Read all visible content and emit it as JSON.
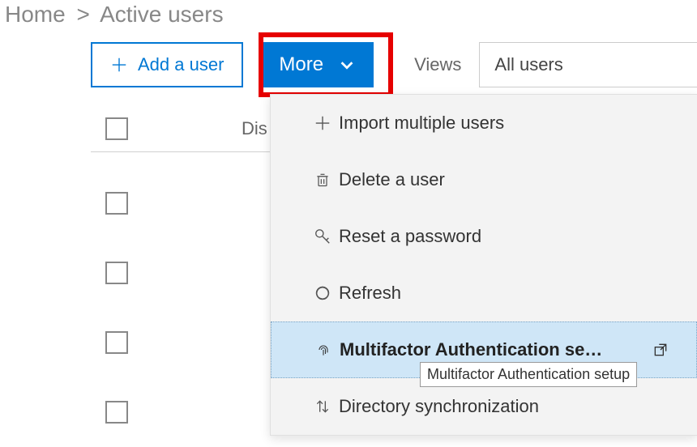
{
  "breadcrumb": {
    "home": "Home",
    "current": "Active users"
  },
  "toolbar": {
    "add_label": "Add a user",
    "more_label": "More",
    "views_label": "Views",
    "views_value": "All users"
  },
  "table": {
    "col_display_name": "Dis"
  },
  "dropdown": {
    "items": [
      {
        "label": "Import multiple users"
      },
      {
        "label": "Delete a user"
      },
      {
        "label": "Reset a password"
      },
      {
        "label": "Refresh"
      },
      {
        "label": "Multifactor Authentication se…"
      },
      {
        "label": "Directory synchronization"
      }
    ]
  },
  "tooltip": "Multifactor Authentication setup"
}
